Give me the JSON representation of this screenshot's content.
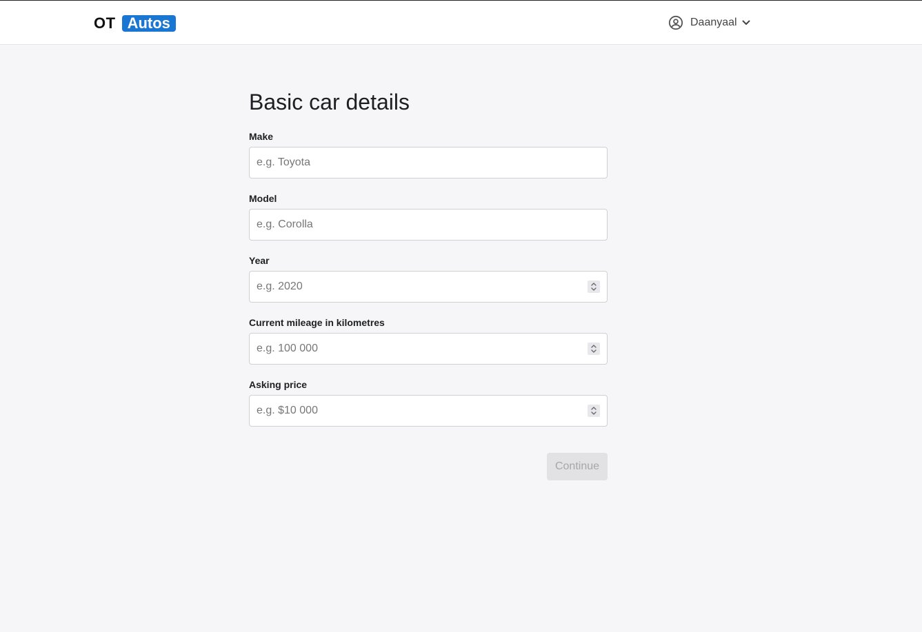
{
  "header": {
    "logo_part1": "OT",
    "logo_part2": "Autos",
    "user_name": "Daanyaal",
    "icons": {
      "user": "user-circle-icon",
      "dropdown": "chevron-down-icon"
    },
    "brand_color": "#1976d2"
  },
  "form": {
    "title": "Basic car details",
    "fields": [
      {
        "label": "Make",
        "placeholder": "e.g. Toyota",
        "value": ""
      },
      {
        "label": "Model",
        "placeholder": "e.g. Corolla",
        "value": ""
      },
      {
        "label": "Year",
        "placeholder": "e.g. 2020",
        "value": ""
      },
      {
        "label": "Current mileage in kilometres",
        "placeholder": "e.g. 100 000",
        "value": ""
      },
      {
        "label": "Asking price",
        "placeholder": "e.g. $10 000",
        "value": ""
      }
    ],
    "continue_label": "Continue",
    "continue_disabled": true
  }
}
